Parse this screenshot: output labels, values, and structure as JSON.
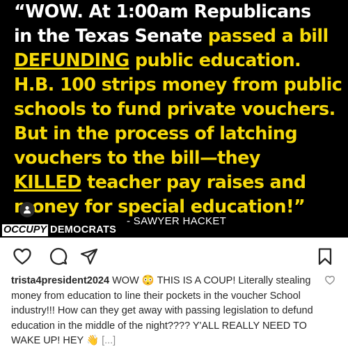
{
  "post_image": {
    "quote_lines": [
      [
        {
          "t": "“WOW. At 1:00am Republicans",
          "c": "white"
        }
      ],
      [
        {
          "t": "in the Texas Senate ",
          "c": "white"
        },
        {
          "t": "passed a bill",
          "c": "yellow"
        }
      ],
      [
        {
          "t": "DEFUNDING",
          "c": "yellow-underline"
        },
        {
          "t": " public education.",
          "c": "yellow"
        }
      ],
      [
        {
          "t": "H.B. 100 strips money from public",
          "c": "yellow"
        }
      ],
      [
        {
          "t": "schools to fund private vouchers.",
          "c": "yellow"
        }
      ],
      [
        {
          "t": "But in the process of latching",
          "c": "yellow"
        }
      ],
      [
        {
          "t": "vouchers to the bill—they",
          "c": "yellow"
        }
      ],
      [
        {
          "t": "KILLED",
          "c": "yellow-underline"
        },
        {
          "t": " teacher pay raises and",
          "c": "yellow"
        }
      ],
      [
        {
          "t": "money for special education!”",
          "c": "yellow"
        }
      ]
    ],
    "attribution": "- SAWYER HACKET",
    "logo": {
      "part1": "OCCUPY",
      "part2": "DEMOCRATS"
    },
    "colors": {
      "yellow": "#f5d90a",
      "white": "#ffffff",
      "background": "#000000"
    }
  },
  "actions": {
    "icons": [
      "heart-icon",
      "comment-icon",
      "share-icon",
      "bookmark-icon"
    ]
  },
  "caption": {
    "username": "trista4president2024",
    "text": " WOW 😳 THIS IS A COUP!  Literally stealing money from education to line their pockets in the voucher School industry!!! How can they get away with passing legislation to defund education in the middle of the night???? Y'ALL REALLY NEED TO WAKE UP! HEY 👋 ",
    "more": "[...]"
  }
}
